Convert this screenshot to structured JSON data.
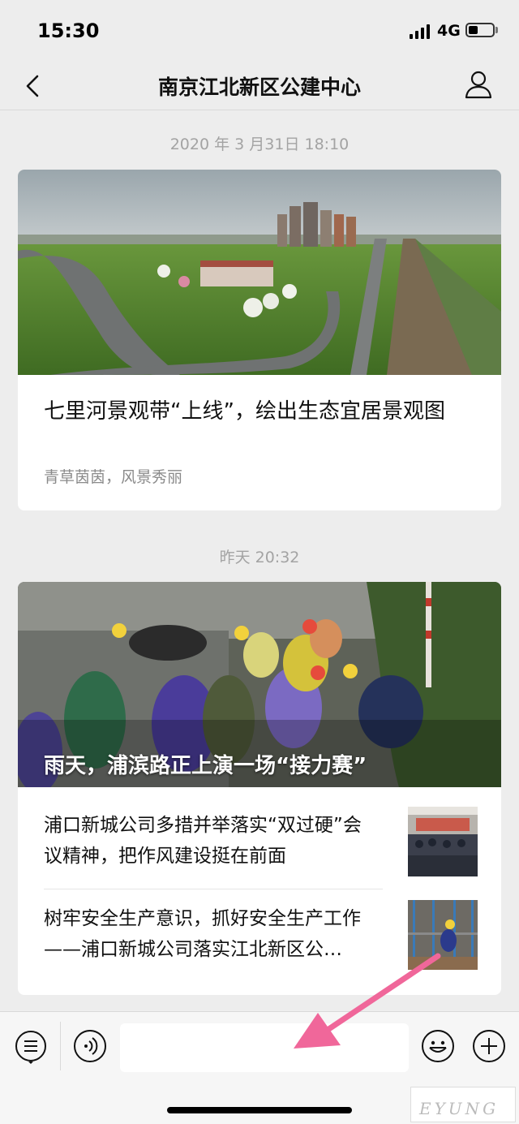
{
  "status_bar": {
    "time": "15:30",
    "network": "4G",
    "battery_percent": 40
  },
  "nav": {
    "title": "南京江北新区公建中心"
  },
  "messages": [
    {
      "timestamp": "2020 年 3 月31日 18:10",
      "article": {
        "title": "七里河景观带“上线”，绘出生态宜居景观图",
        "digest": "青草茵茵，风景秀丽"
      }
    },
    {
      "timestamp": "昨天 20:32",
      "lead": {
        "title": "雨天，浦滨路正上演一场“接力赛”"
      },
      "items": [
        {
          "title": "浦口新城公司多措并举落实“双过硬”会议精神，把作风建设挺在前面"
        },
        {
          "title": "树牢安全生产意识，抓好安全生产工作——浦口新城公司落实江北新区公…"
        }
      ]
    }
  ],
  "toolbar": {
    "input_value": ""
  },
  "colors": {
    "annotation_arrow": "#f0679a",
    "background": "#ededed"
  },
  "icons": {
    "back": "chevron-left-icon",
    "profile": "person-icon",
    "menu": "list-icon",
    "voice": "voice-icon",
    "emoji": "smiley-icon",
    "add": "plus-icon"
  }
}
